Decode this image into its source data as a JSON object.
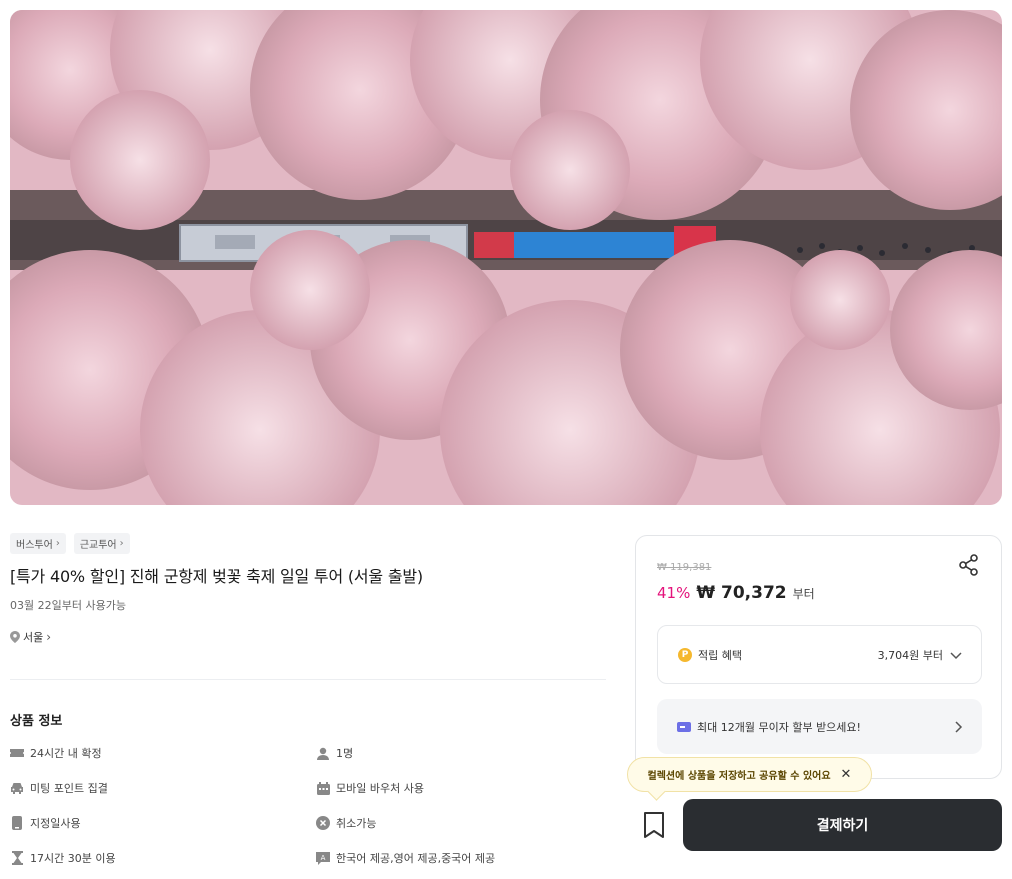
{
  "hero": {
    "image": "cherry-blossom-train-aerial"
  },
  "breadcrumbs": [
    {
      "label": "버스투어"
    },
    {
      "label": "근교투어"
    }
  ],
  "product": {
    "title": "[특가 40% 할인] 진해 군항제 벚꽃 축제 일일 투어 (서울 출발)",
    "availability": "03월 22일부터 사용가능",
    "location": "서울"
  },
  "info": {
    "section_title": "상품 정보",
    "items": [
      {
        "icon": "ticket-icon",
        "label": "24시간 내 확정"
      },
      {
        "icon": "person-icon",
        "label": "1명"
      },
      {
        "icon": "car-icon",
        "label": "미팅 포인트 집결"
      },
      {
        "icon": "calendar-icon",
        "label": "모바일 바우처 사용"
      },
      {
        "icon": "phone-icon",
        "label": "지정일사용"
      },
      {
        "icon": "cancel-icon",
        "label": "취소가능"
      },
      {
        "icon": "hourglass-icon",
        "label": "17시간 30분 이용"
      },
      {
        "icon": "language-icon",
        "label": "한국어 제공,영어 제공,중국어 제공"
      }
    ]
  },
  "price": {
    "original": "₩ 119,381",
    "discount": "41%",
    "current": "₩ 70,372",
    "suffix": "부터"
  },
  "benefit": {
    "label": "적립 혜택",
    "value": "3,704원 부터"
  },
  "installment": {
    "label": "최대 12개월 무이자 할부 받으세요!"
  },
  "tooltip": {
    "text": "컬렉션에 상품을 저장하고 공유할 수 있어요"
  },
  "actions": {
    "pay_label": "결제하기"
  },
  "colors": {
    "discount": "#e4137b",
    "pay_button": "#2a2d31",
    "coin": "#f5b82e",
    "card": "#6c6fe6"
  }
}
